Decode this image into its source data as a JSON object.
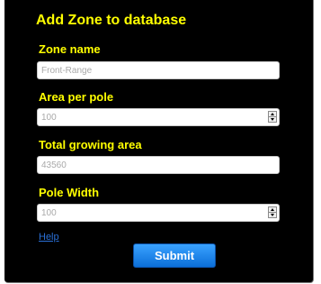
{
  "form": {
    "title": "Add Zone to database",
    "fields": [
      {
        "label": "Zone name",
        "type": "text",
        "placeholder": "Front-Range",
        "value": ""
      },
      {
        "label": "Area per pole",
        "type": "number",
        "placeholder": "100",
        "value": ""
      },
      {
        "label": "Total growing area",
        "type": "text",
        "placeholder": "43560",
        "value": ""
      },
      {
        "label": "Pole Width",
        "type": "number",
        "placeholder": "100",
        "value": ""
      }
    ],
    "help_link": "Help",
    "submit_label": "Submit"
  },
  "colors": {
    "panel_background": "#000000",
    "label_text": "#ffff00",
    "link": "#2a6fd6",
    "submit_button": "#0b6fd8"
  },
  "icons": {
    "number_spinner": "up-down-spinner-icon"
  }
}
